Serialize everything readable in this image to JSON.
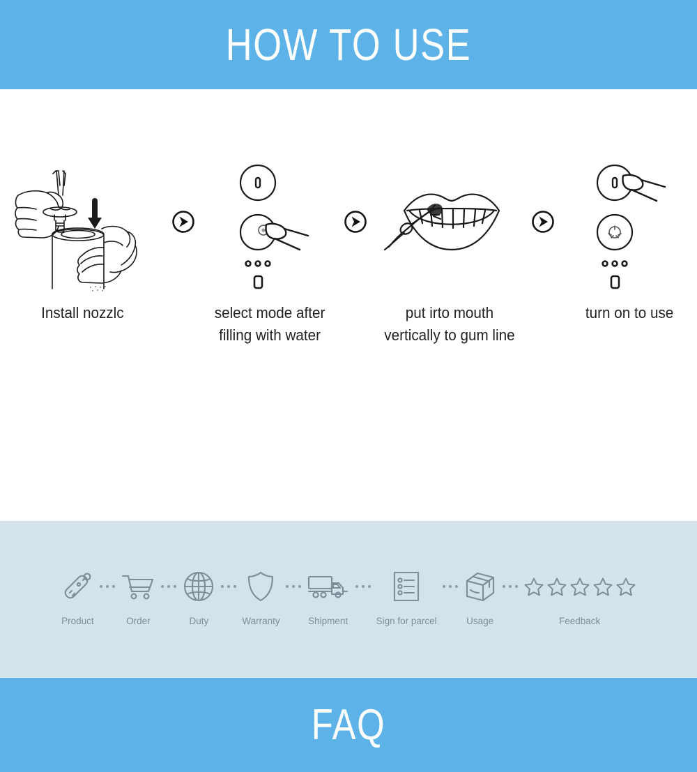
{
  "header": {
    "title": "HOW TO USE",
    "background_color": "#5db3e8",
    "text_color": "#ffffff"
  },
  "steps": {
    "items": [
      {
        "index": 1,
        "caption": "Install nozzlc",
        "illustration": "hands-installing-nozzle-icon"
      },
      {
        "index": 2,
        "caption_line1": "select mode after",
        "caption_line2": "filling with water",
        "illustration": "finger-pressing-mode-button-icon"
      },
      {
        "index": 3,
        "caption_line1": "put irto mouth",
        "caption_line2": "vertically to gum line",
        "illustration": "nozzle-in-mouth-icon"
      },
      {
        "index": 4,
        "caption": "turn on to use",
        "illustration": "finger-pressing-power-button-icon"
      }
    ],
    "separator_icon": "circled-arrow-right-icon",
    "text_color": "#231f20"
  },
  "service_band": {
    "background_color": "#d4e2ea",
    "label_color": "#7d8d99",
    "separator_icon": "dots-separator-icon",
    "items": [
      {
        "label": "Product",
        "icon": "electric-flosser-icon"
      },
      {
        "label": "Order",
        "icon": "shopping-cart-icon"
      },
      {
        "label": "Duty",
        "icon": "globe-icon"
      },
      {
        "label": "Warranty",
        "icon": "shield-icon"
      },
      {
        "label": "Shipment",
        "icon": "delivery-truck-icon"
      },
      {
        "label": "Sign for parcel",
        "icon": "checklist-icon"
      },
      {
        "label": "Usage",
        "icon": "package-box-icon"
      },
      {
        "label": "Feedback",
        "icon": "five-stars-icon",
        "star_count": 5
      }
    ]
  },
  "footer": {
    "title": "FAQ",
    "background_color": "#5db3e8",
    "text_color": "#ffffff"
  }
}
